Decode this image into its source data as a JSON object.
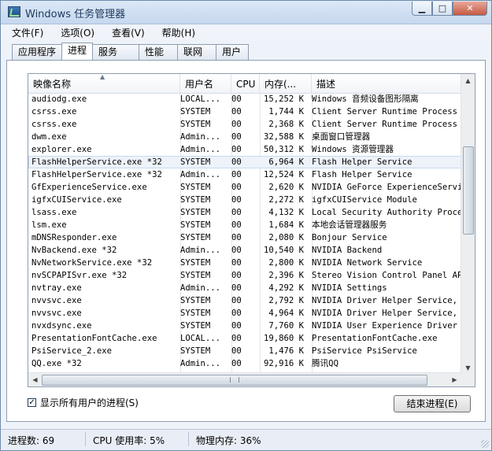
{
  "window": {
    "title": "Windows 任务管理器",
    "controls": {
      "minimize": "▁",
      "maximize": "□",
      "close": "✕"
    }
  },
  "menu": [
    "文件(F)",
    "选项(O)",
    "查看(V)",
    "帮助(H)"
  ],
  "tabs": [
    "应用程序",
    "进程",
    "服务",
    "性能",
    "联网",
    "用户"
  ],
  "active_tab": "进程",
  "columns": {
    "name": "映像名称",
    "user": "用户名",
    "cpu": "CPU",
    "memory": "内存(...",
    "description": "描述"
  },
  "processes": [
    {
      "name": "audiodg.exe",
      "user": "LOCAL...",
      "cpu": "00",
      "mem": "15,252 K",
      "desc": "Windows 音频设备图形隔离"
    },
    {
      "name": "csrss.exe",
      "user": "SYSTEM",
      "cpu": "00",
      "mem": "1,744 K",
      "desc": "Client Server Runtime Process"
    },
    {
      "name": "csrss.exe",
      "user": "SYSTEM",
      "cpu": "00",
      "mem": "2,368 K",
      "desc": "Client Server Runtime Process"
    },
    {
      "name": "dwm.exe",
      "user": "Admin...",
      "cpu": "00",
      "mem": "32,588 K",
      "desc": "桌面窗口管理器"
    },
    {
      "name": "explorer.exe",
      "user": "Admin...",
      "cpu": "00",
      "mem": "50,312 K",
      "desc": "Windows 资源管理器"
    },
    {
      "name": "FlashHelperService.exe *32",
      "user": "SYSTEM",
      "cpu": "00",
      "mem": "6,964 K",
      "desc": "Flash Helper Service"
    },
    {
      "name": "FlashHelperService.exe *32",
      "user": "Admin...",
      "cpu": "00",
      "mem": "12,524 K",
      "desc": "Flash Helper Service"
    },
    {
      "name": "GfExperienceService.exe",
      "user": "SYSTEM",
      "cpu": "00",
      "mem": "2,620 K",
      "desc": "NVIDIA GeForce ExperienceServic"
    },
    {
      "name": "igfxCUIService.exe",
      "user": "SYSTEM",
      "cpu": "00",
      "mem": "2,272 K",
      "desc": "igfxCUIService Module"
    },
    {
      "name": "lsass.exe",
      "user": "SYSTEM",
      "cpu": "00",
      "mem": "4,132 K",
      "desc": "Local Security Authority Proces"
    },
    {
      "name": "lsm.exe",
      "user": "SYSTEM",
      "cpu": "00",
      "mem": "1,684 K",
      "desc": "本地会话管理器服务"
    },
    {
      "name": "mDNSResponder.exe",
      "user": "SYSTEM",
      "cpu": "00",
      "mem": "2,080 K",
      "desc": "Bonjour Service"
    },
    {
      "name": "NvBackend.exe *32",
      "user": "Admin...",
      "cpu": "00",
      "mem": "10,540 K",
      "desc": "NVIDIA Backend"
    },
    {
      "name": "NvNetworkService.exe *32",
      "user": "SYSTEM",
      "cpu": "00",
      "mem": "2,800 K",
      "desc": "NVIDIA Network Service"
    },
    {
      "name": "nvSCPAPISvr.exe *32",
      "user": "SYSTEM",
      "cpu": "00",
      "mem": "2,396 K",
      "desc": "Stereo Vision Control Panel API"
    },
    {
      "name": "nvtray.exe",
      "user": "Admin...",
      "cpu": "00",
      "mem": "4,292 K",
      "desc": "NVIDIA Settings"
    },
    {
      "name": "nvvsvc.exe",
      "user": "SYSTEM",
      "cpu": "00",
      "mem": "2,792 K",
      "desc": "NVIDIA Driver Helper Service, V"
    },
    {
      "name": "nvvsvc.exe",
      "user": "SYSTEM",
      "cpu": "00",
      "mem": "4,964 K",
      "desc": "NVIDIA Driver Helper Service, V"
    },
    {
      "name": "nvxdsync.exe",
      "user": "SYSTEM",
      "cpu": "00",
      "mem": "7,760 K",
      "desc": "NVIDIA User Experience Driver C"
    },
    {
      "name": "PresentationFontCache.exe",
      "user": "LOCAL...",
      "cpu": "00",
      "mem": "19,860 K",
      "desc": "PresentationFontCache.exe"
    },
    {
      "name": "PsiService_2.exe",
      "user": "SYSTEM",
      "cpu": "00",
      "mem": "1,476 K",
      "desc": "PsiService PsiService"
    },
    {
      "name": "QQ.exe *32",
      "user": "Admin...",
      "cpu": "00",
      "mem": "92,916 K",
      "desc": "腾讯QQ"
    }
  ],
  "selected_index": 5,
  "show_all_users": {
    "label": "显示所有用户的进程(S)",
    "checked": true
  },
  "end_process_label": "结束进程(E)",
  "status": {
    "processes": "进程数: 69",
    "cpu": "CPU 使用率: 5%",
    "memory": "物理内存: 36%"
  }
}
